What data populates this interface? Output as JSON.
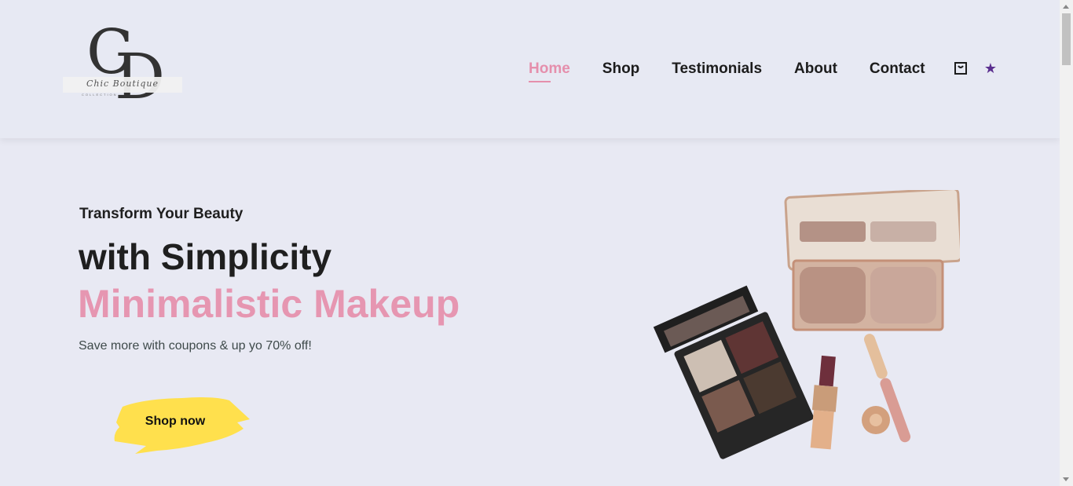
{
  "brand": {
    "monogram_c": "C",
    "monogram_d": "D",
    "script_name": "Chic Boutique",
    "tagline": "COLLECTION"
  },
  "nav": {
    "items": [
      {
        "label": "Home",
        "active": true
      },
      {
        "label": "Shop",
        "active": false
      },
      {
        "label": "Testimonials",
        "active": false
      },
      {
        "label": "About",
        "active": false
      },
      {
        "label": "Contact",
        "active": false
      }
    ],
    "icons": [
      "shopping-bag-icon",
      "star-icon"
    ]
  },
  "hero": {
    "pretitle": "Transform Your Beauty",
    "title": "with Simplicity",
    "highlight": "Minimalistic Makeup",
    "subtitle": "Save more with coupons & up yo 70% off!",
    "cta_label": "Shop now"
  },
  "colors": {
    "background": "#e8e9f3",
    "accent_pink": "#e696b1",
    "cta_yellow": "#ffe04d",
    "star_purple": "#5b2f8f"
  }
}
